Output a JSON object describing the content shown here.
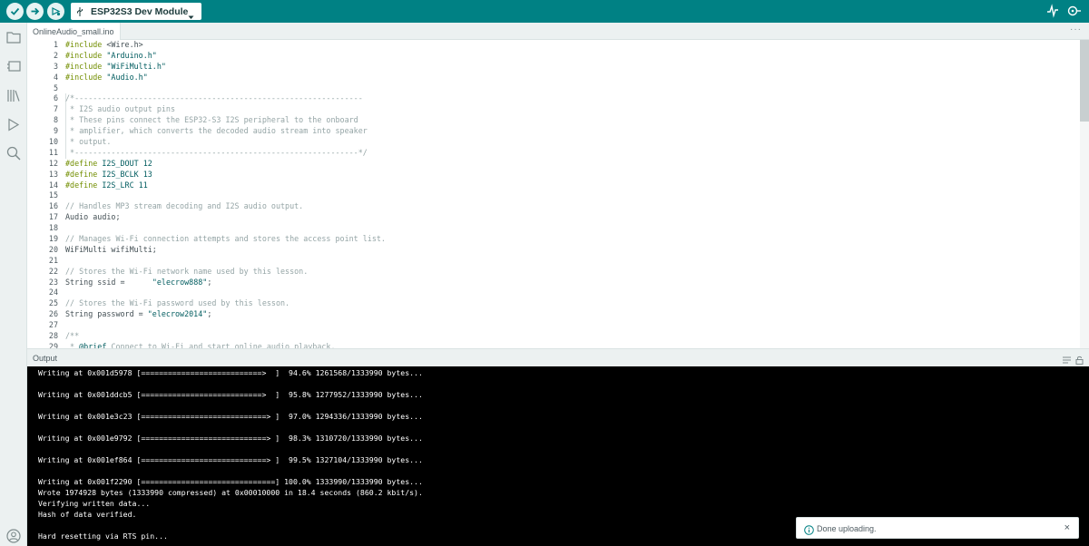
{
  "toolbar": {
    "board_name": "ESP32S3 Dev Module",
    "colors": {
      "bar": "#008184",
      "button": "#e6f3f3"
    }
  },
  "tabs": [
    {
      "label": "OnlineAudio_small.ino"
    }
  ],
  "tabs_more": "···",
  "editor": {
    "line_numbers": [
      "1",
      "2",
      "3",
      "4",
      "5",
      "6",
      "7",
      "8",
      "9",
      "10",
      "11",
      "12",
      "13",
      "14",
      "15",
      "16",
      "17",
      "18",
      "19",
      "20",
      "21",
      "22",
      "23",
      "24",
      "25",
      "26",
      "27",
      "28",
      "29"
    ]
  },
  "output": {
    "title": "Output",
    "lines": [
      "Writing at 0x001d5978 [===========================>  ]  94.6% 1261568/1333990 bytes...",
      "",
      "Writing at 0x001ddcb5 [===========================>  ]  95.8% 1277952/1333990 bytes...",
      "",
      "Writing at 0x001e3c23 [============================> ]  97.0% 1294336/1333990 bytes...",
      "",
      "Writing at 0x001e9792 [============================> ]  98.3% 1310720/1333990 bytes...",
      "",
      "Writing at 0x001ef864 [============================> ]  99.5% 1327104/1333990 bytes...",
      "",
      "Writing at 0x001f2290 [==============================] 100.0% 1333990/1333990 bytes...",
      "Wrote 1974928 bytes (1333990 compressed) at 0x00010000 in 18.4 seconds (860.2 kbit/s).",
      "Verifying written data...",
      "Hash of data verified.",
      "",
      "Hard resetting via RTS pin..."
    ]
  },
  "notification": {
    "message": "Done uploading.",
    "close": "×"
  }
}
